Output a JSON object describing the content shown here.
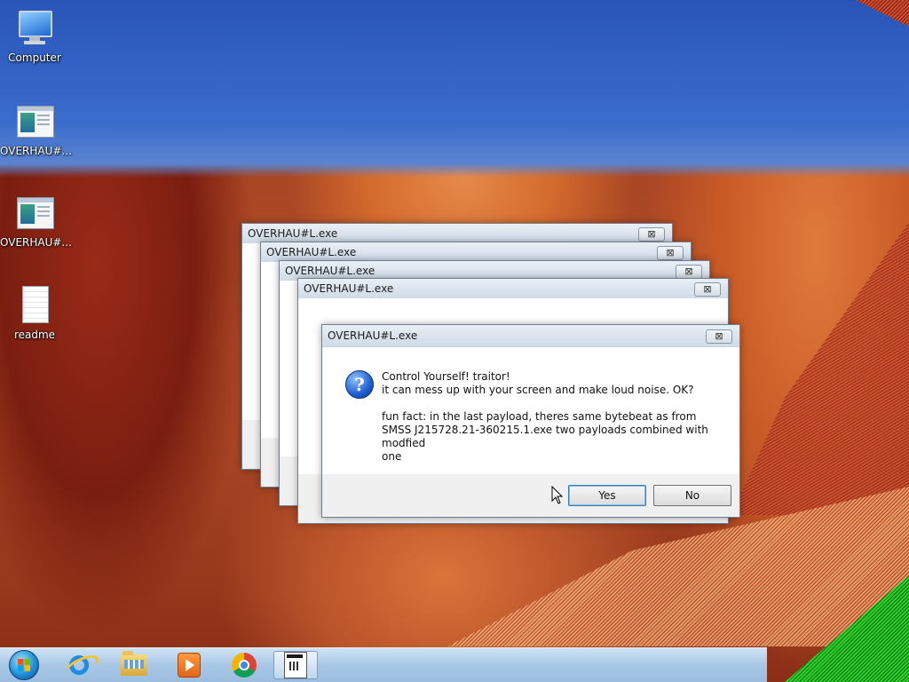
{
  "desktop": {
    "icons": [
      {
        "label": "Computer",
        "icon": "computer-icon"
      },
      {
        "label": "OVERHAU#...",
        "icon": "program-window-icon"
      },
      {
        "label": "OVERHAU#...",
        "icon": "program-window-icon"
      },
      {
        "label": "readme",
        "icon": "text-document-icon"
      }
    ]
  },
  "back_windows": [
    {
      "title": "OVERHAU#L.exe",
      "close_glyph": "⊠"
    },
    {
      "title": "OVERHAU#L.exe",
      "close_glyph": "⊠"
    },
    {
      "title": "OVERHAU#L.exe",
      "close_glyph": "⊠"
    },
    {
      "title": "OVERHAU#L.exe",
      "close_glyph": "⊠"
    }
  ],
  "dialog": {
    "title": "OVERHAU#L.exe",
    "close_glyph": "⊠",
    "icon": "question-icon",
    "icon_glyph": "?",
    "lines": [
      "Control Yourself! traitor!",
      "it can mess up with your screen and make loud noise. OK?"
    ],
    "fun_fact": [
      "fun fact: in the last payload, theres same bytebeat as from",
      "SMSS J215728.21-360215.1.exe two payloads combined with modfied",
      "one"
    ],
    "yes_label": "Yes",
    "no_label": "No"
  },
  "taskbar": {
    "items": [
      {
        "name": "start-button",
        "icon": "windows-orb-icon"
      },
      {
        "name": "internet-explorer",
        "icon": "internet-explorer-icon"
      },
      {
        "name": "file-explorer",
        "icon": "folder-icon"
      },
      {
        "name": "media-player",
        "icon": "media-player-icon"
      },
      {
        "name": "chrome",
        "icon": "chrome-icon"
      },
      {
        "name": "overhaul-app",
        "icon": "application-icon",
        "active": true
      }
    ]
  },
  "colors": {
    "taskbar": "#a9c7e6",
    "dialog_body": "#ffffff",
    "dialog_button_area": "#f0f0f0",
    "default_button_border": "#3c7fb1"
  }
}
